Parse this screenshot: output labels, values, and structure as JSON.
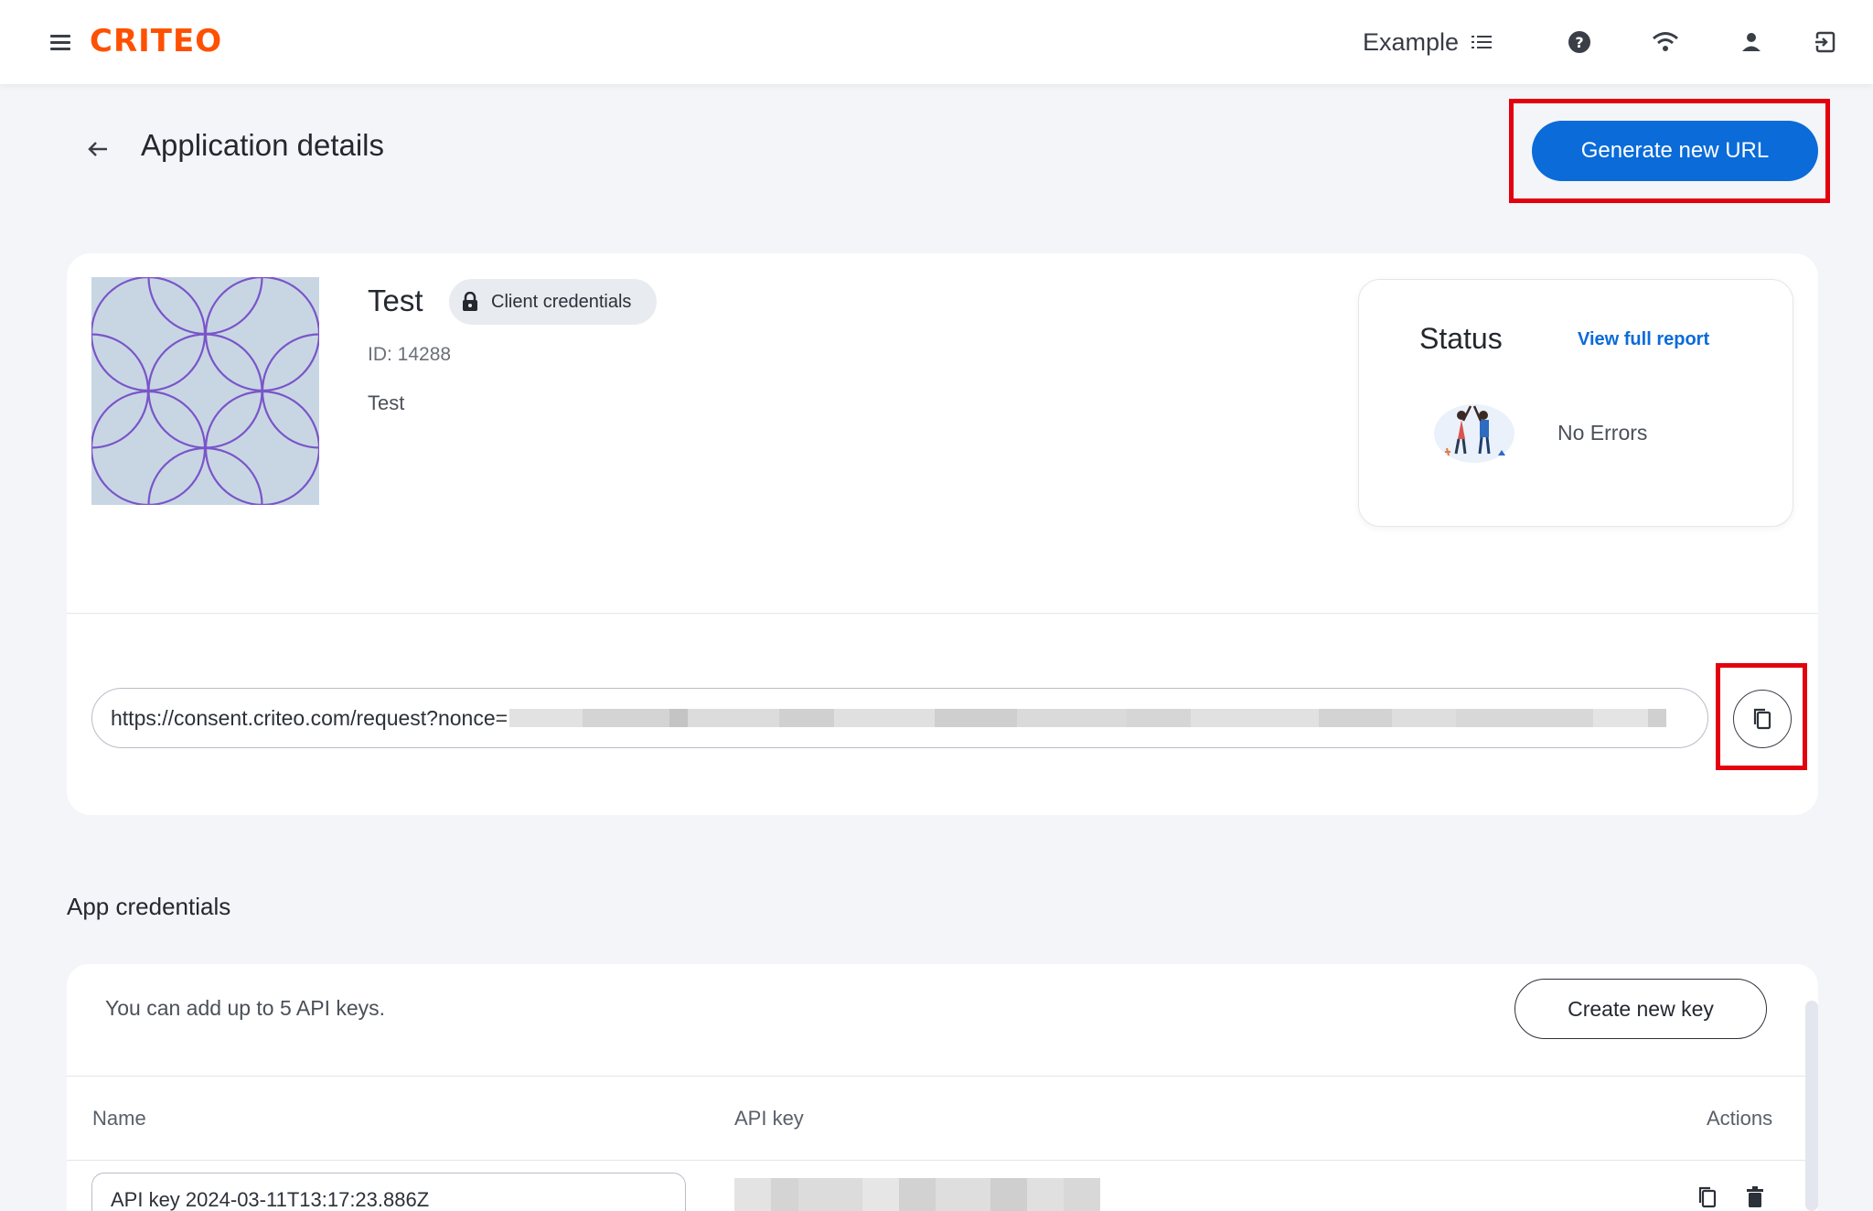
{
  "topbar": {
    "logo": "CRITEO",
    "account_name": "Example",
    "icons": [
      "menu-icon",
      "list-icon",
      "help-icon",
      "wifi-icon",
      "user-icon",
      "logout-icon"
    ]
  },
  "header": {
    "title": "Application details",
    "generate_button": "Generate new URL"
  },
  "app": {
    "name": "Test",
    "chip_label": "Client credentials",
    "id_text": "ID: 14288",
    "description": "Test",
    "url_prefix": "https://consent.criteo.com/request?nonce="
  },
  "status": {
    "title": "Status",
    "link": "View full report",
    "value": "No Errors"
  },
  "credentials": {
    "section_title": "App credentials",
    "hint": "You can add up to 5 API keys.",
    "create_button": "Create new key",
    "columns": [
      "Name",
      "API key",
      "Actions"
    ],
    "rows": [
      {
        "name": "API key 2024-03-11T13:17:23.886Z"
      }
    ]
  },
  "colors": {
    "brand": "#fe5000",
    "primary": "#0a6bd9",
    "highlight": "#e3000f",
    "background": "#f4f5f8"
  }
}
